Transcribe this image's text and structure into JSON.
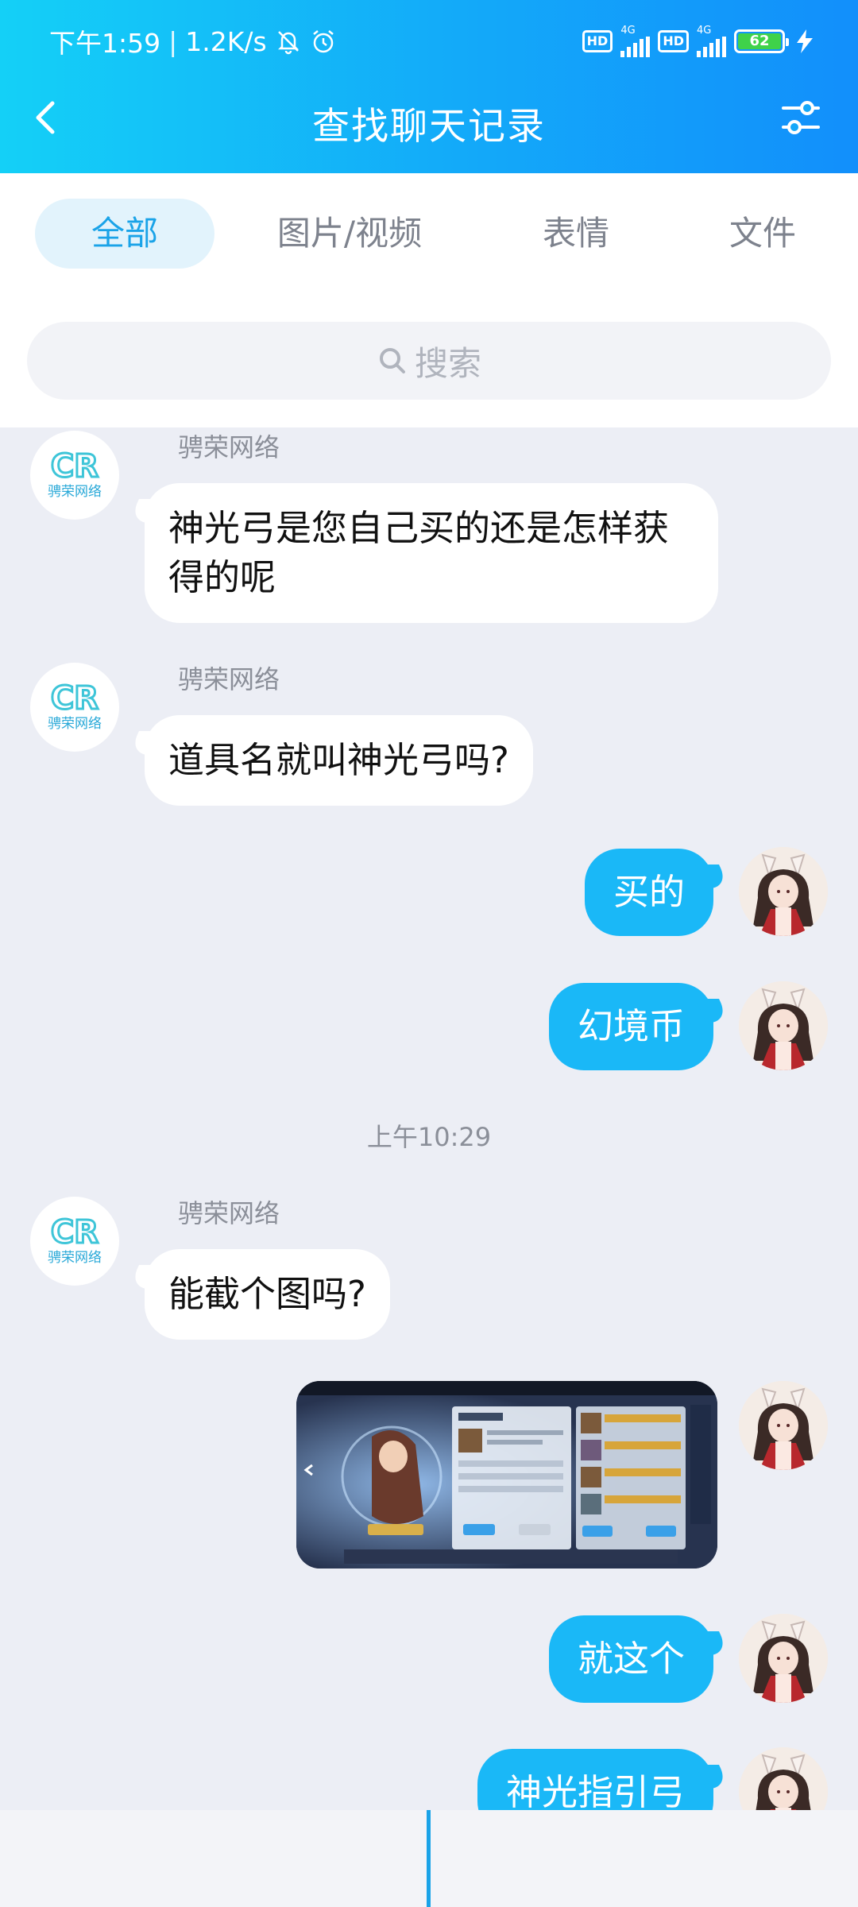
{
  "status": {
    "time": "下午1:59",
    "speed": "1.2K/s",
    "hd1": "HD",
    "net1": "4G",
    "hd2": "HD",
    "net2": "4G",
    "battery": "62"
  },
  "header": {
    "title": "查找聊天记录"
  },
  "tabs": [
    {
      "label": "全部"
    },
    {
      "label": "图片/视频"
    },
    {
      "label": "表情"
    },
    {
      "label": "文件"
    }
  ],
  "search": {
    "placeholder": "搜索"
  },
  "messages": [
    {
      "sender": "骋荣网络",
      "text_line1": "神光弓是您自己买的还是怎样获",
      "text_line2": "得的呢"
    },
    {
      "sender": "骋荣网络",
      "text": "道具名就叫神光弓吗?"
    },
    {
      "text": "买的"
    },
    {
      "text": "幻境币"
    },
    {
      "time": "上午10:29"
    },
    {
      "sender": "骋荣网络",
      "text": "能截个图吗?"
    },
    {
      "image": "screenshot-image"
    },
    {
      "text": "就这个"
    },
    {
      "text": "神光指引弓"
    }
  ],
  "avatar_cr_text": "骋荣网络",
  "colors": {
    "header_start": "#14d0f7",
    "header_end": "#128ffb",
    "accent": "#1aa3e8",
    "outgoing_bubble": "#1ab8f7",
    "chat_background": "#eceef5"
  }
}
